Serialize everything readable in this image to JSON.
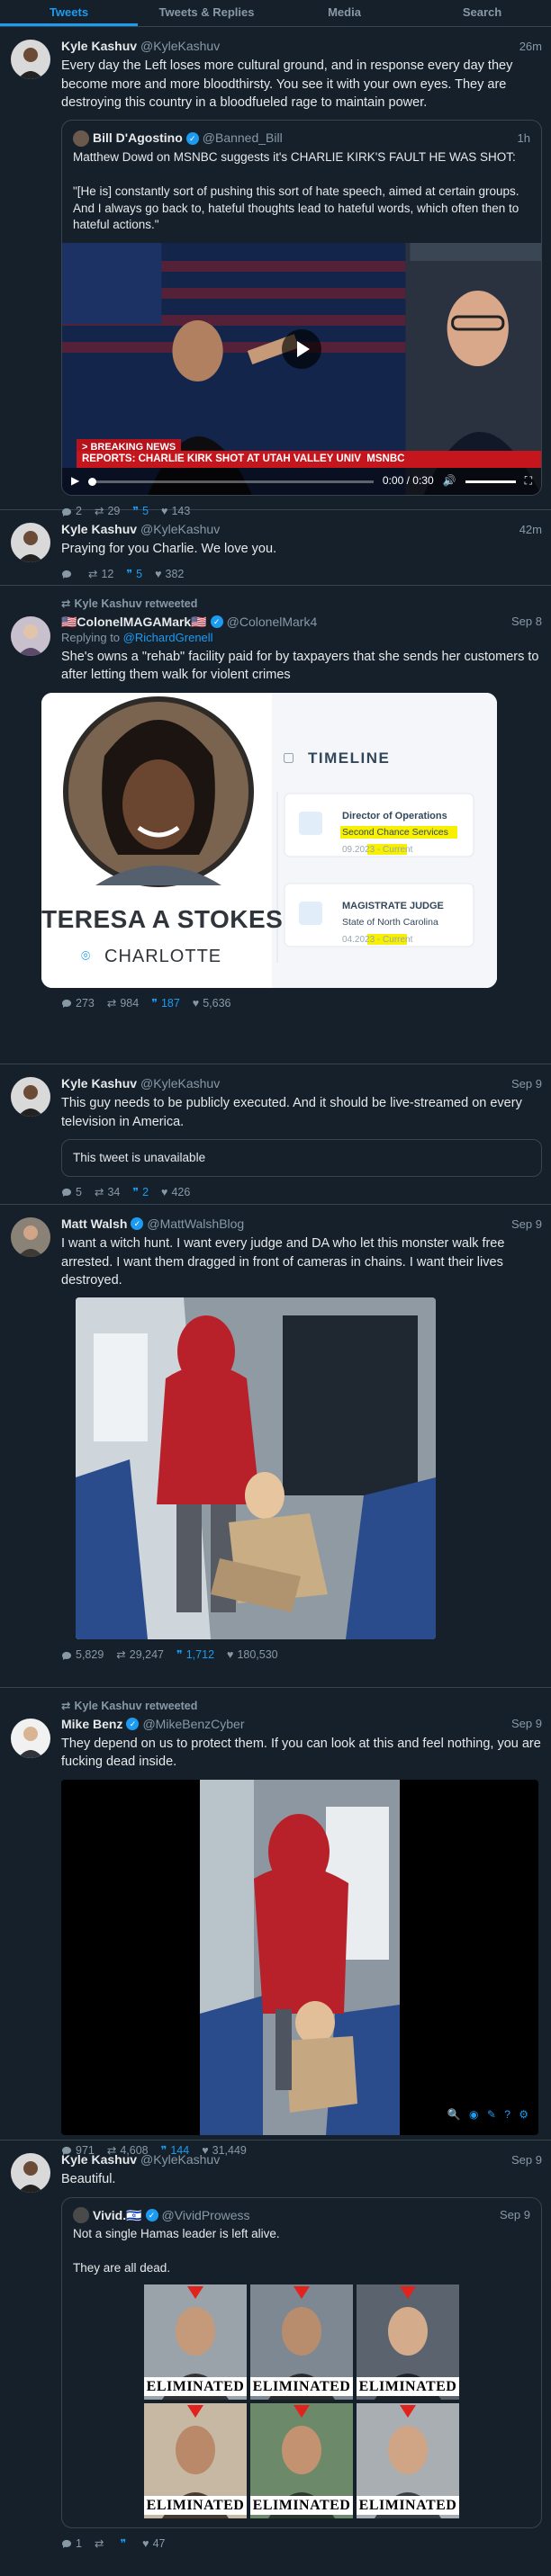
{
  "tabs": [
    "Tweets",
    "Tweets & Replies",
    "Media",
    "Search"
  ],
  "tweets": [
    {
      "name": "Kyle Kashuv",
      "handle": "@KyleKashuv",
      "time": "26m",
      "text": "Every day the Left loses more cultural ground, and in response every day they become more and more bloodthirsty. You see it with your own eyes. They are destroying this country in a bloodfueled rage to maintain power.",
      "quote": {
        "name": "Bill D'Agostino",
        "handle": "@Banned_Bill",
        "time": "1h",
        "text": "Matthew Dowd on MSNBC suggests it's CHARLIE KIRK'S FAULT HE WAS SHOT:\n\n\"[He is] constantly sort of pushing this sort of hate speech, aimed at certain groups. And I always go back to, hateful thoughts lead to hateful words, which often then to hateful actions.\"",
        "video": {
          "breaking": "> BREAKING NEWS",
          "chyron": "REPORTS: CHARLIE KIRK SHOT AT UTAH VALLEY UNIV",
          "network": "MSNBC",
          "time": "0:00 / 0:30"
        }
      },
      "stats": {
        "replies": "2",
        "retweets": "29",
        "quotes": "5",
        "likes": "143"
      }
    },
    {
      "name": "Kyle Kashuv",
      "handle": "@KyleKashuv",
      "time": "42m",
      "text": "Praying for you Charlie. We love you.",
      "stats": {
        "replies": "",
        "retweets": "12",
        "quotes": "5",
        "likes": "382"
      }
    },
    {
      "retweeted_by": "Kyle Kashuv retweeted",
      "name": "🇺🇸ColonelMAGAMark🇺🇸",
      "handle": "@ColonelMark4",
      "time": "Sep 8",
      "reply_prefix": "Replying to ",
      "reply_to": "@RichardGrenell",
      "text": "She's owns a \"rehab\" facility paid for by taxpayers that she sends her customers to after letting them walk for violent crimes",
      "card": {
        "person_name": "TERESA A STOKES",
        "city": "CHARLOTTE",
        "timeline_title": "TIMELINE",
        "job1_title": "Director of Operations",
        "job1_org": "Second Chance Services",
        "job1_date": "09.2023 - ",
        "job1_current": "Current",
        "job2_title": "MAGISTRATE JUDGE",
        "job2_org": "State of North Carolina",
        "job2_date": "04.2023 - ",
        "job2_current": "Current"
      },
      "stats": {
        "replies": "273",
        "retweets": "984",
        "quotes": "187",
        "likes": "5,636"
      }
    },
    {
      "name": "Kyle Kashuv",
      "handle": "@KyleKashuv",
      "time": "Sep 9",
      "text": "This guy needs to be publicly executed. And it should be live-streamed on every television in America.",
      "unavailable": "This tweet is unavailable",
      "stats": {
        "replies": "5",
        "retweets": "34",
        "quotes": "2",
        "likes": "426"
      }
    },
    {
      "name": "Matt Walsh",
      "handle": "@MattWalshBlog",
      "time": "Sep 9",
      "text": "I want a witch hunt. I want every judge and DA who let this monster walk free arrested. I want them dragged in front of cameras in chains. I want their lives destroyed.",
      "stats": {
        "replies": "5,829",
        "retweets": "29,247",
        "quotes": "1,712",
        "likes": "180,530"
      }
    },
    {
      "retweeted_by": "Kyle Kashuv retweeted",
      "name": "Mike Benz",
      "handle": "@MikeBenzCyber",
      "time": "Sep 9",
      "text": "They depend on us to protect them. If you can look at this and feel nothing, you are fucking dead inside.",
      "stats": {
        "replies": "971",
        "retweets": "4,608",
        "quotes": "144",
        "likes": "31,449"
      }
    },
    {
      "name": "Kyle Kashuv",
      "handle": "@KyleKashuv",
      "time": "Sep 9",
      "text": "Beautiful.",
      "quote": {
        "name": "Vivid.🇮🇱",
        "handle": "@VividProwess",
        "time": "Sep 9",
        "text": "Not a single Hamas leader is left alive.\n\nThey are all dead.",
        "label": "ELIMINATED"
      },
      "stats": {
        "replies": "1",
        "retweets": "",
        "quotes": "",
        "likes": "47"
      }
    }
  ]
}
